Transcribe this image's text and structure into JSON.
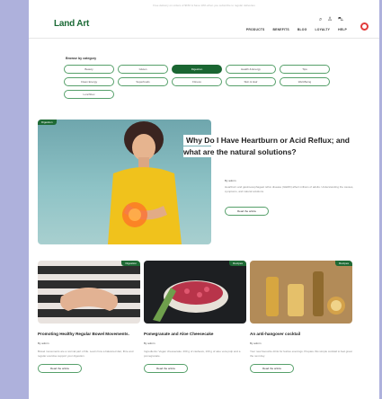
{
  "topbar": {
    "text": "Free delivery on orders of $150 & Save 10% when you subscribe to regular deliveries"
  },
  "header": {
    "logo": "Land Art",
    "utility": {
      "search": "Search",
      "account": "Account",
      "cart": "Cart"
    },
    "nav": [
      "PRODUCTS",
      "BENEFITS",
      "BLOG",
      "LOYALTY",
      "HELP"
    ]
  },
  "categories": {
    "label": "Browse by category",
    "items": [
      "Beauty",
      "Gluten",
      "Digestion",
      "Health & Energy",
      "Tips",
      "Clean Energy",
      "Superfoods",
      "Fitness",
      "Skin & Hair",
      "Well-Being",
      "Lunchbox"
    ],
    "active": "Digestion"
  },
  "hero": {
    "tag": "Digestion",
    "title": "Why Do I Have Heartburn or Acid Reflux; and what are the natural solutions?",
    "meta": "By admin",
    "excerpt": "Heartburn and gastroesophageal reflux disease (GERD) affect millions of adults. Understanding the causes, symptoms, and natural solutions.",
    "button": "Read the article"
  },
  "cards": [
    {
      "tag": "Digestion",
      "title": "Promoting Healthy Regular Bowel Movements.",
      "meta": "By admin",
      "excerpt": "Bowel movements are a normal part of life. Learn how a balanced diet, fibre and regular exercise support your digestion.",
      "button": "Read the article"
    },
    {
      "tag": "Recipes",
      "title": "Pomegranate and Aloe Cheesecake",
      "meta": "By admin",
      "excerpt": "Ingredients: Vegan cheesecake. 200 g of cashews, 100 g of aloe vera pulp and a pomegranate.",
      "button": "Read the article"
    },
    {
      "tag": "Recipes",
      "title": "An anti-hangover cocktail",
      "meta": "By admin",
      "excerpt": "Your new favourite drink for festive evenings. Prepare this simple cocktail to feel great the next day.",
      "button": "Read the article"
    }
  ]
}
